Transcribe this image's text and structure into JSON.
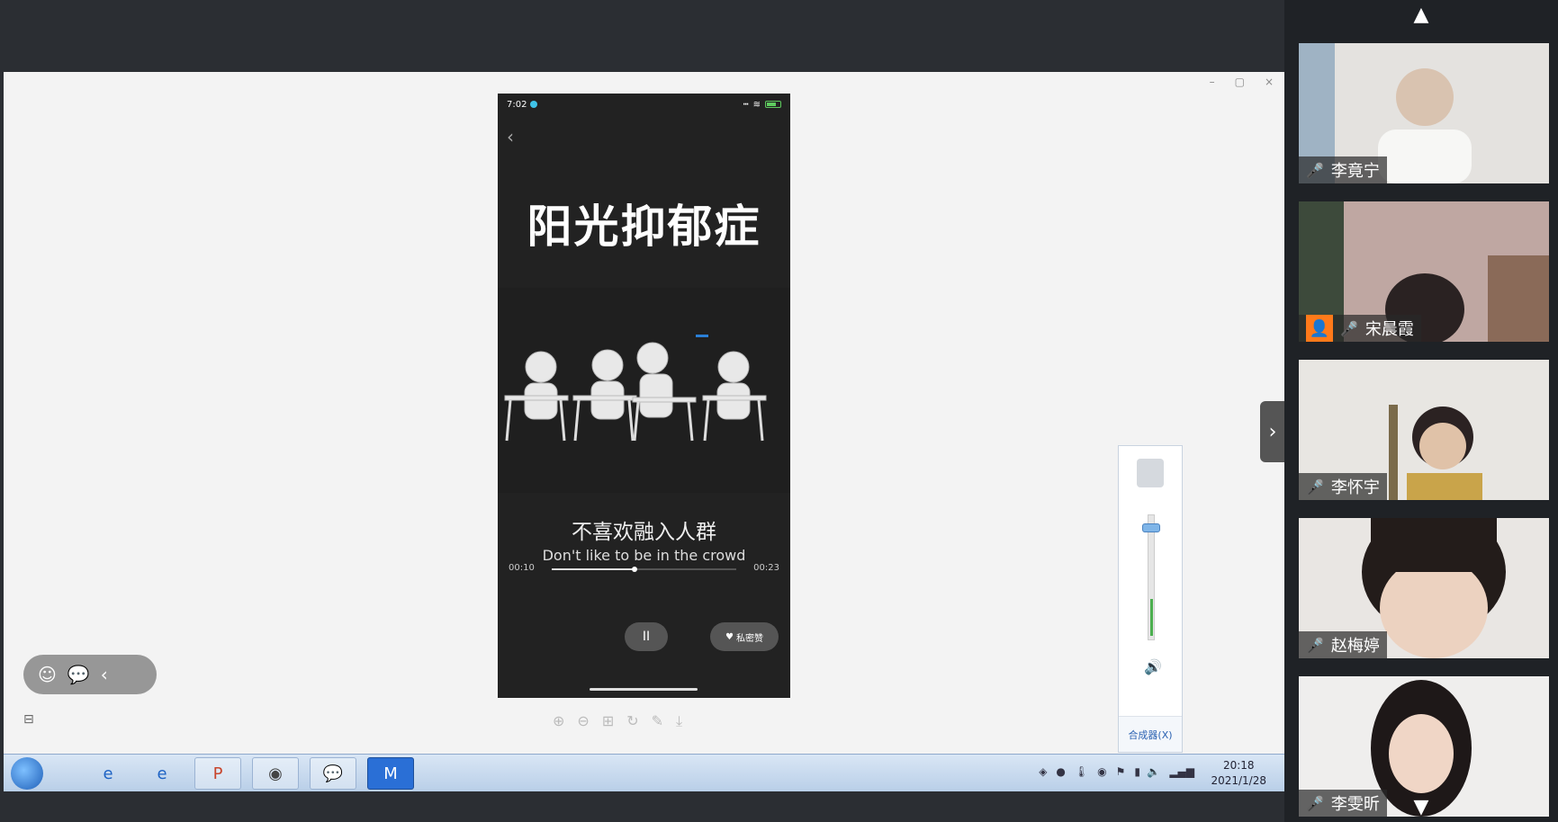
{
  "shared_window": {
    "controls": [
      "–",
      "▢",
      "×"
    ]
  },
  "phone": {
    "status_time": "7:02",
    "title": "阳光抑郁症",
    "subtitle_cn": "不喜欢融入人群",
    "subtitle_en": "Don't like to be in the crowd",
    "time_current": "00:10",
    "time_total": "00:23",
    "progress": 0.45,
    "pause_label": "II",
    "like_label": "私密赞"
  },
  "viewer_tools": [
    "⊕",
    "⊖",
    "⊞",
    "↻",
    "✎",
    "⤓"
  ],
  "mixer": {
    "link_label": "合成器(X)",
    "volume": 0.3
  },
  "floating": {
    "icons": [
      "☺",
      "💬",
      "‹"
    ]
  },
  "taskbar": {
    "apps": [
      "e",
      "e",
      "P",
      "◉",
      "💬",
      "M"
    ],
    "clock_time": "20:18",
    "clock_date": "2021/1/28"
  },
  "participants": [
    {
      "name": "李竟宁",
      "muted": true
    },
    {
      "name": "宋晨霞",
      "muted": false
    },
    {
      "name": "李怀宇",
      "muted": true
    },
    {
      "name": "赵梅婷",
      "muted": true
    },
    {
      "name": "李雯昕",
      "muted": false
    }
  ]
}
